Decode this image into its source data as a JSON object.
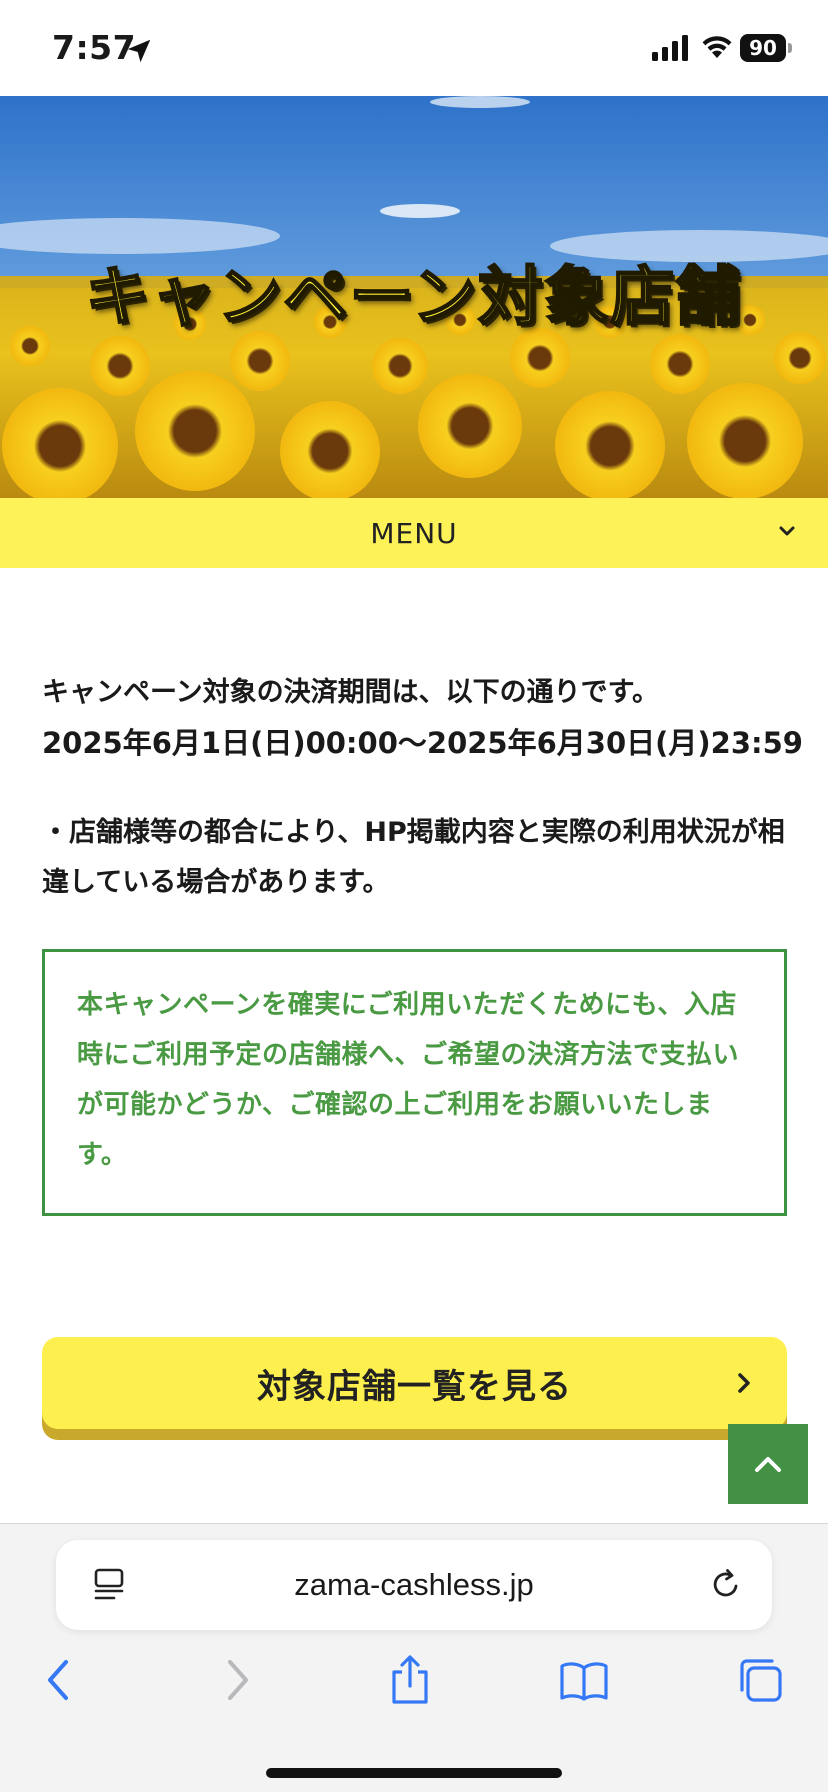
{
  "status_bar": {
    "time": "7:57",
    "battery": "90"
  },
  "hero": {
    "title": "キャンペーン対象店舗"
  },
  "menu": {
    "label": "MENU"
  },
  "content": {
    "period_intro": "キャンペーン対象の決済期間は、以下の通りです。",
    "period_range": "2025年6月1日(日)00:00〜2025年6月30日(月)23:59",
    "notice": "・店舗様等の都合により、HP掲載内容と実際の利用状況が相違している場合があります。",
    "green_notice": "本キャンペーンを確実にご利用いただくためにも、入店時にご利用予定の店舗様へ、ご希望の決済方法で支払いが可能かどうか、ご確認の上ご利用をお願いいたします。"
  },
  "cta": {
    "label": "対象店舗一覧を見る"
  },
  "browser": {
    "url": "zama-cashless.jp"
  },
  "icons": {
    "location": "location-arrow-icon",
    "signal": "cellular-signal-icon",
    "wifi": "wifi-icon",
    "chevron": "chevron-down-icon",
    "cta_arrow": "chevron-right-icon",
    "back_to_top": "chevron-up-icon",
    "reader": "reader-mode-icon",
    "reload": "reload-icon",
    "back": "back-arrow-icon",
    "forward": "forward-arrow-icon",
    "share": "share-icon",
    "bookmarks": "bookmarks-icon",
    "tabs": "tabs-icon"
  },
  "colors": {
    "menu_bg": "#fdf257",
    "cta_bg": "#fdf04e",
    "green": "#439145",
    "safari_blue": "#3478f6"
  }
}
